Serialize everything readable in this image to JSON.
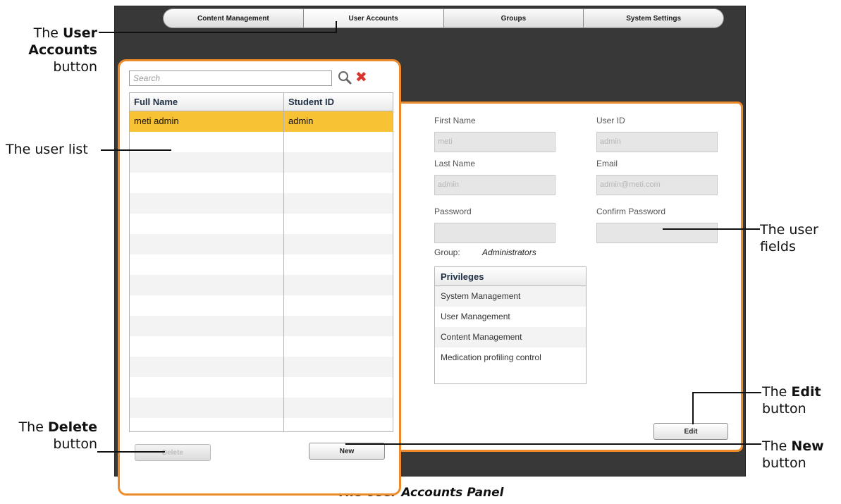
{
  "tabs": [
    {
      "label": "Content Management",
      "active": false
    },
    {
      "label": "User Accounts",
      "active": true
    },
    {
      "label": "Groups",
      "active": false
    },
    {
      "label": "System Settings",
      "active": false
    }
  ],
  "user_list": {
    "search_placeholder": "Search",
    "search_icon": "magnifier-icon",
    "clear_icon": "red-x-icon",
    "clear_glyph": "✖",
    "columns": [
      "Full Name",
      "Student ID"
    ],
    "rows": [
      {
        "full_name": "meti admin",
        "student_id": "admin",
        "selected": true
      }
    ],
    "delete_label": "Delete",
    "new_label": "New"
  },
  "user_fields": {
    "first_name_label": "First Name",
    "first_name_value": "meti",
    "user_id_label": "User ID",
    "user_id_value": "admin",
    "last_name_label": "Last Name",
    "last_name_value": "admin",
    "email_label": "Email",
    "email_value": "admin@meti.com",
    "password_label": "Password",
    "password_value": "",
    "confirm_password_label": "Confirm Password",
    "confirm_password_value": "",
    "group_label": "Group:",
    "group_value": "Administrators",
    "privileges_header": "Privileges",
    "privileges": [
      "System Management",
      "User Management",
      "Content Management",
      "Medication profiling control"
    ],
    "edit_label": "Edit"
  },
  "callouts": {
    "user_accounts": {
      "pre": "The ",
      "bold": "User Accounts",
      "post": "button"
    },
    "user_list": "The user list",
    "user_fields": {
      "line1": "The user",
      "line2": "fields"
    },
    "edit": {
      "pre": "The ",
      "bold": "Edit",
      "post": "button"
    },
    "delete": {
      "pre": "The ",
      "bold": "Delete",
      "post": "button"
    },
    "new": {
      "pre": "The ",
      "bold": "New",
      "post": "button"
    }
  },
  "caption": "The User Accounts Panel",
  "colors": {
    "accent_orange": "#ef8a2b",
    "selected_row": "#f7c234",
    "frame_dark": "#383838",
    "clear_red": "#d9342b"
  }
}
